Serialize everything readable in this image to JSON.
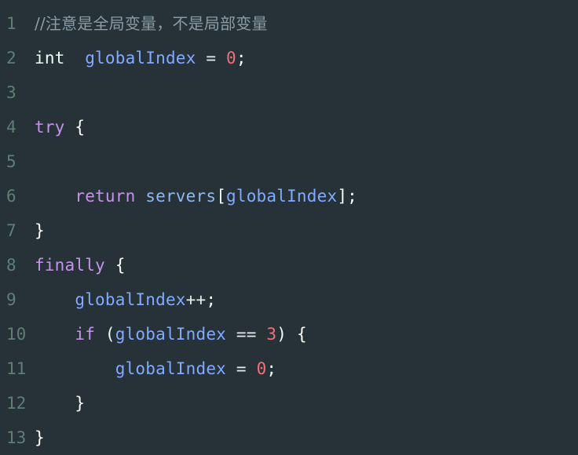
{
  "editor": {
    "language": "java",
    "theme": "material-palenight",
    "background_color": "#263238",
    "gutter_color": "#5f7e76",
    "default_text_color": "#eeffff",
    "colors": {
      "comment": "#8b9ba6",
      "keyword": "#c792ea",
      "variable": "#82aaff",
      "property": "#8fb8ef",
      "number": "#f07178",
      "punctuation": "#eeffff",
      "operator": "#e5eced",
      "type": "#eeffff"
    },
    "lines": [
      {
        "number": "1",
        "tokens": [
          {
            "text": "//注意是全局变量，不是局部变量",
            "kind": "comment"
          }
        ]
      },
      {
        "number": "2",
        "tokens": [
          {
            "text": "int",
            "kind": "type"
          },
          {
            "text": "  ",
            "kind": "plain"
          },
          {
            "text": "globalIndex",
            "kind": "var"
          },
          {
            "text": " ",
            "kind": "plain"
          },
          {
            "text": "=",
            "kind": "op"
          },
          {
            "text": " ",
            "kind": "plain"
          },
          {
            "text": "0",
            "kind": "num"
          },
          {
            "text": ";",
            "kind": "punct"
          }
        ]
      },
      {
        "number": "3",
        "tokens": []
      },
      {
        "number": "4",
        "tokens": [
          {
            "text": "try",
            "kind": "keyword"
          },
          {
            "text": " ",
            "kind": "plain"
          },
          {
            "text": "{",
            "kind": "brace"
          }
        ]
      },
      {
        "number": "5",
        "tokens": []
      },
      {
        "number": "6",
        "tokens": [
          {
            "text": "    ",
            "kind": "plain"
          },
          {
            "text": "return",
            "kind": "return"
          },
          {
            "text": " ",
            "kind": "plain"
          },
          {
            "text": "servers",
            "kind": "prop"
          },
          {
            "text": "[",
            "kind": "punct"
          },
          {
            "text": "globalIndex",
            "kind": "var"
          },
          {
            "text": "]",
            "kind": "punct"
          },
          {
            "text": ";",
            "kind": "punct"
          }
        ]
      },
      {
        "number": "7",
        "tokens": [
          {
            "text": "}",
            "kind": "brace"
          }
        ]
      },
      {
        "number": "8",
        "tokens": [
          {
            "text": "finally",
            "kind": "keyword"
          },
          {
            "text": " ",
            "kind": "plain"
          },
          {
            "text": "{",
            "kind": "brace"
          }
        ]
      },
      {
        "number": "9",
        "tokens": [
          {
            "text": "    ",
            "kind": "plain"
          },
          {
            "text": "globalIndex",
            "kind": "var"
          },
          {
            "text": "++",
            "kind": "op"
          },
          {
            "text": ";",
            "kind": "punct"
          }
        ]
      },
      {
        "number": "10",
        "tokens": [
          {
            "text": "    ",
            "kind": "plain"
          },
          {
            "text": "if",
            "kind": "keyword"
          },
          {
            "text": " ",
            "kind": "plain"
          },
          {
            "text": "(",
            "kind": "punct"
          },
          {
            "text": "globalIndex",
            "kind": "var"
          },
          {
            "text": " ",
            "kind": "plain"
          },
          {
            "text": "==",
            "kind": "op"
          },
          {
            "text": " ",
            "kind": "plain"
          },
          {
            "text": "3",
            "kind": "num"
          },
          {
            "text": ")",
            "kind": "punct"
          },
          {
            "text": " ",
            "kind": "plain"
          },
          {
            "text": "{",
            "kind": "brace"
          }
        ]
      },
      {
        "number": "11",
        "tokens": [
          {
            "text": "        ",
            "kind": "plain"
          },
          {
            "text": "globalIndex",
            "kind": "var"
          },
          {
            "text": " ",
            "kind": "plain"
          },
          {
            "text": "=",
            "kind": "op"
          },
          {
            "text": " ",
            "kind": "plain"
          },
          {
            "text": "0",
            "kind": "num"
          },
          {
            "text": ";",
            "kind": "punct"
          }
        ]
      },
      {
        "number": "12",
        "tokens": [
          {
            "text": "    ",
            "kind": "plain"
          },
          {
            "text": "}",
            "kind": "brace"
          }
        ]
      },
      {
        "number": "13",
        "tokens": [
          {
            "text": "}",
            "kind": "brace"
          }
        ]
      }
    ]
  }
}
